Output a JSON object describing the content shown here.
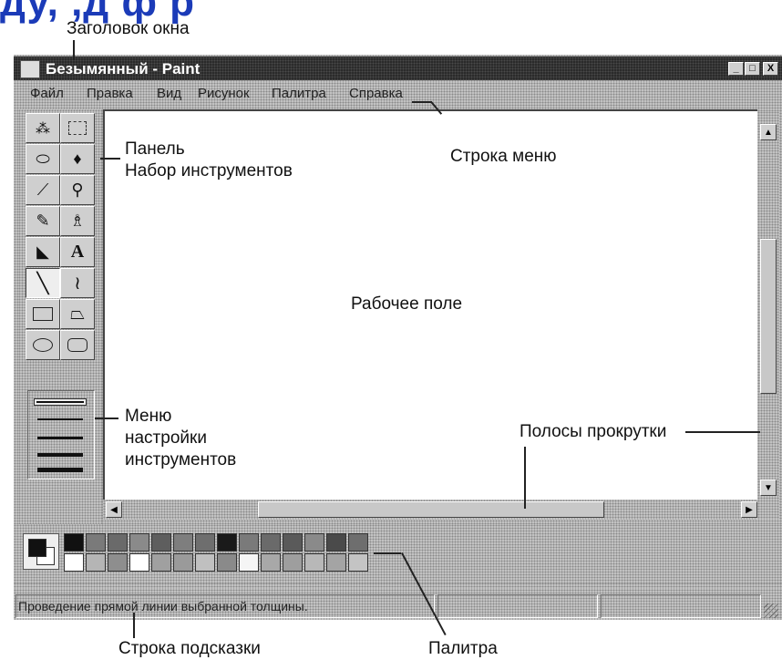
{
  "heading_fragment": "ду, ,д        ф р",
  "window": {
    "title": "Безымянный - Paint",
    "controls": [
      "_",
      "□",
      "X"
    ]
  },
  "menu": [
    "Файл",
    "Правка",
    "Вид",
    "Рисунок",
    "Палитра",
    "Справка"
  ],
  "tools": [
    {
      "name": "free-select-icon",
      "glyph": "⬚"
    },
    {
      "name": "rect-select-icon",
      "glyph": "⬚"
    },
    {
      "name": "eraser-icon",
      "glyph": "▱"
    },
    {
      "name": "fill-icon",
      "glyph": "◆"
    },
    {
      "name": "color-picker-icon",
      "glyph": "✎"
    },
    {
      "name": "magnifier-icon",
      "glyph": "🔍"
    },
    {
      "name": "pencil-icon",
      "glyph": "✏"
    },
    {
      "name": "brush-icon",
      "glyph": "♙"
    },
    {
      "name": "airbrush-icon",
      "glyph": "▰"
    },
    {
      "name": "text-icon",
      "glyph": "A"
    },
    {
      "name": "line-icon",
      "glyph": "╲"
    },
    {
      "name": "curve-icon",
      "glyph": "∫"
    },
    {
      "name": "rectangle-icon",
      "glyph": "▭"
    },
    {
      "name": "polygon-icon",
      "glyph": "⏢"
    },
    {
      "name": "ellipse-icon",
      "glyph": "⬭"
    },
    {
      "name": "rounded-rect-icon",
      "glyph": "▢"
    }
  ],
  "status_text": "Проведение прямой линии выбранной толщины.",
  "annotations": {
    "title": "Заголовок окна",
    "menu": "Строка меню",
    "toolbox": [
      "Панель",
      "Набор инструментов"
    ],
    "workspace": "Рабочее поле",
    "tool_options": [
      "Меню",
      "настройки",
      "инструментов"
    ],
    "scrollbars": "Полосы прокрутки",
    "status": "Строка подсказки",
    "palette": "Палитра"
  },
  "palette": {
    "row1": [
      "#111111",
      "#7a7a7a",
      "#6a6a6a",
      "#8a8a8a",
      "#5e5e5e",
      "#7e7e7e",
      "#6e6e6e",
      "#1a1a1a",
      "#7a7a7a",
      "#6a6a6a",
      "#5a5a5a",
      "#8a8a8a",
      "#4a4a4a",
      "#6e6e6e"
    ],
    "row2": [
      "#ffffff",
      "#b5b5b5",
      "#8e8e8e",
      "#ffffff",
      "#a0a0a0",
      "#9a9a9a",
      "#c0c0c0",
      "#8a8a8a",
      "#f5f5f5",
      "#a8a8a8",
      "#9e9e9e",
      "#b8b8b8",
      "#a4a4a4",
      "#c4c4c4"
    ]
  }
}
